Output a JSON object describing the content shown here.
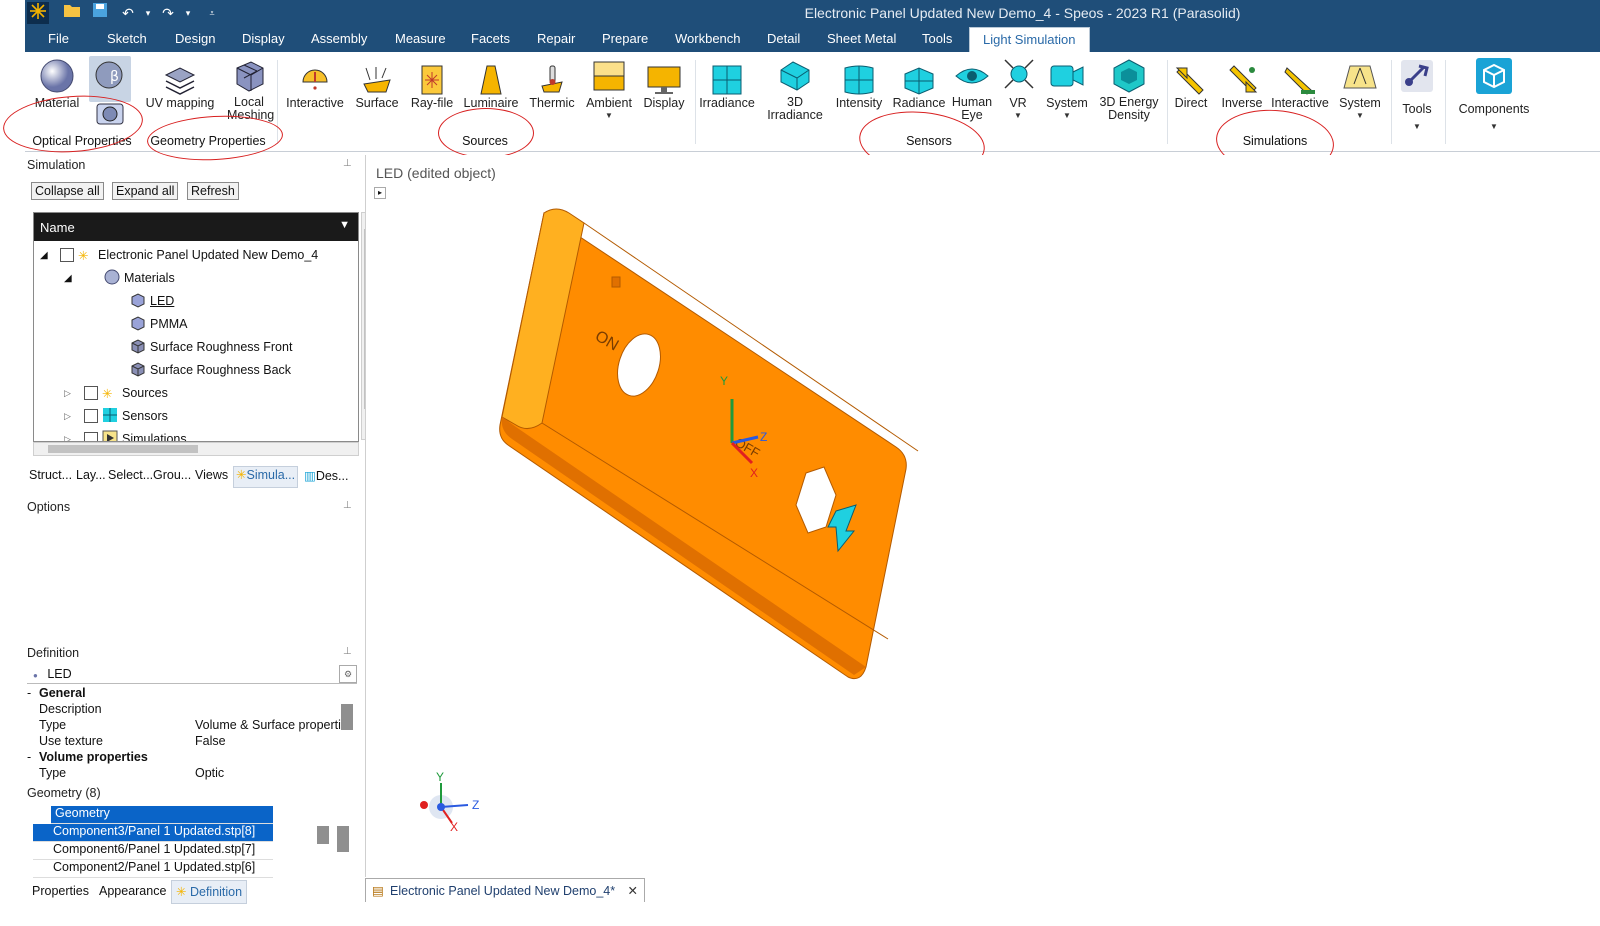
{
  "window": {
    "title": "Electronic Panel Updated New Demo_4 - Speos - 2023 R1 (Parasolid)"
  },
  "menu": [
    "File",
    "Sketch",
    "Design",
    "Display",
    "Assembly",
    "Measure",
    "Facets",
    "Repair",
    "Prepare",
    "Workbench",
    "Detail",
    "Sheet Metal",
    "Tools",
    "Light Simulation"
  ],
  "ribbon": {
    "buttons": {
      "material": "Material",
      "uv_mapping": "UV mapping",
      "local_meshing": "Local\nMeshing",
      "interactive": "Interactive",
      "surface": "Surface",
      "rayfile": "Ray-file",
      "luminaire": "Luminaire",
      "thermic": "Thermic",
      "ambient": "Ambient",
      "display": "Display",
      "irradiance": "Irradiance",
      "irradiance3d": "3D\nIrradiance",
      "intensity": "Intensity",
      "radiance": "Radiance",
      "human_eye": "Human\nEye",
      "vr": "VR",
      "system": "System",
      "energy3d": "3D Energy\nDensity",
      "direct": "Direct",
      "inverse": "Inverse",
      "interactive_sim": "Interactive",
      "system_sim": "System",
      "tools": "Tools",
      "components": "Components"
    },
    "groups": {
      "optical": "Optical Properties",
      "geometry": "Geometry Properties",
      "sources": "Sources",
      "sensors": "Sensors",
      "simulations": "Simulations"
    }
  },
  "simulation_panel": {
    "title": "Simulation",
    "collapse_all": "Collapse all",
    "expand_all": "Expand all",
    "refresh": "Refresh",
    "column": "Name",
    "tree": {
      "root": "Electronic Panel Updated New Demo_4",
      "materials": "Materials",
      "led": "LED",
      "pmma": "PMMA",
      "srf": "Surface Roughness Front",
      "srb": "Surface Roughness Back",
      "sources": "Sources",
      "sensors": "Sensors",
      "simulations": "Simulations"
    }
  },
  "panel_tabs": [
    "Struct...",
    "Lay...",
    "Select...",
    "Grou...",
    "Views",
    "Simula...",
    "Des..."
  ],
  "options": {
    "title": "Options"
  },
  "definition": {
    "title": "Definition",
    "object": "LED",
    "general": "General",
    "rows": [
      {
        "k": "Description",
        "v": ""
      },
      {
        "k": "Type",
        "v": "Volume & Surface properties"
      },
      {
        "k": "Use texture",
        "v": "False"
      }
    ],
    "volume": "Volume properties",
    "vtype_k": "Type",
    "vtype_v": "Optic",
    "geometry_label": "Geometry (8)",
    "geometry_header": "Geometry",
    "geometry_items": [
      "Component3/Panel 1 Updated.stp[8]",
      "Component6/Panel 1 Updated.stp[7]",
      "Component2/Panel 1 Updated.stp[6]"
    ]
  },
  "bottom_tabs": [
    "Properties",
    "Appearance",
    "Definition"
  ],
  "viewport": {
    "label": "LED (edited object)",
    "on_text": "ON",
    "off_text": "OFF",
    "axis_x": "X",
    "axis_y": "Y",
    "axis_z": "Z"
  },
  "doc_tab": "Electronic Panel Updated New Demo_4*",
  "colors": {
    "ribbon_blue": "#1f4e79",
    "part_orange": "#ff8c00",
    "selection": "#0a64c8",
    "annotation_red": "#d82020"
  }
}
